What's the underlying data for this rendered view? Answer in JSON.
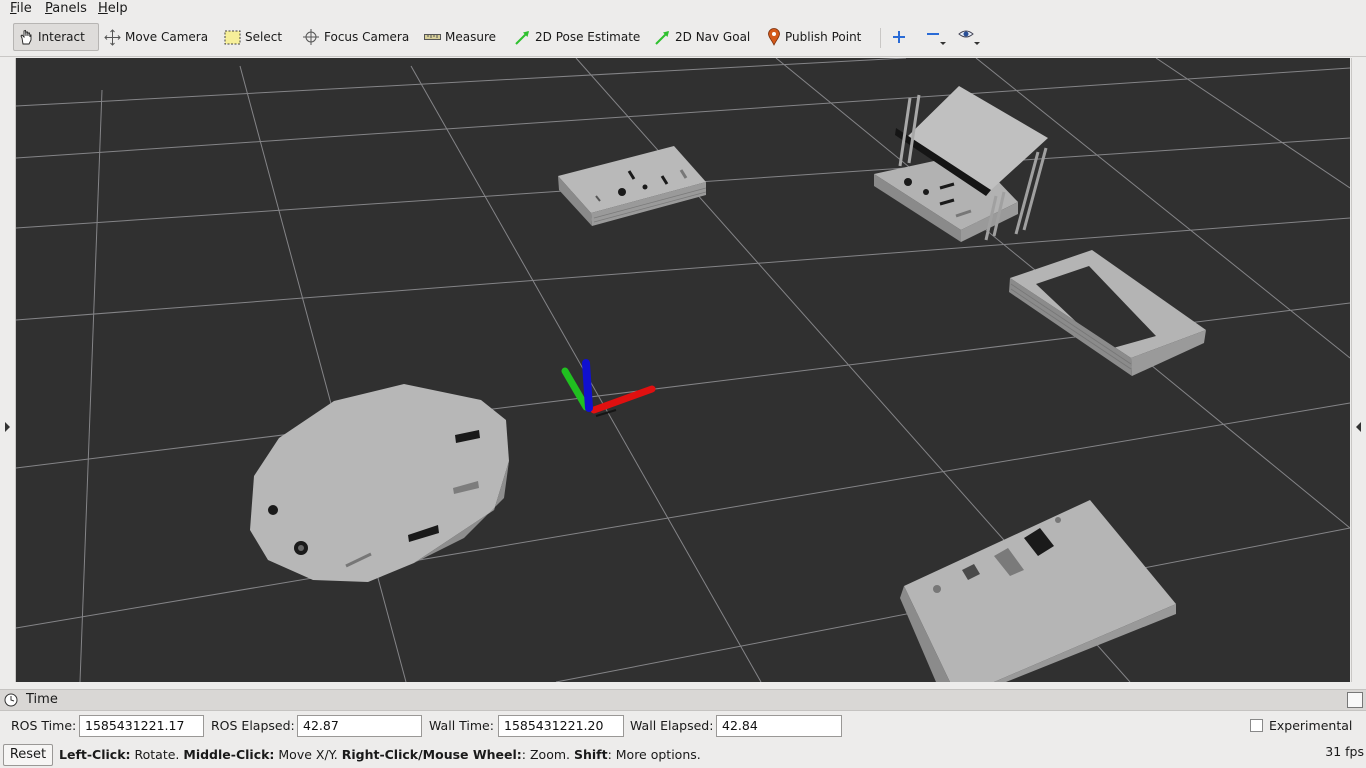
{
  "menubar": {
    "file": {
      "u": "F",
      "rest": "ile"
    },
    "panels": {
      "u": "P",
      "rest": "anels"
    },
    "help": {
      "u": "H",
      "rest": "elp"
    }
  },
  "toolbar": {
    "interact": "Interact",
    "move_camera": "Move Camera",
    "select": "Select",
    "focus_camera": "Focus Camera",
    "measure": "Measure",
    "pose_estimate": "2D Pose Estimate",
    "nav_goal": "2D Nav Goal",
    "publish_point": "Publish Point"
  },
  "time_panel": {
    "title": "Time",
    "ros_time_label": "ROS Time:",
    "ros_time": "1585431221.17",
    "ros_elapsed_label": "ROS Elapsed:",
    "ros_elapsed": "42.87",
    "wall_time_label": "Wall Time:",
    "wall_time": "1585431221.20",
    "wall_elapsed_label": "Wall Elapsed:",
    "wall_elapsed": "42.84",
    "experimental_label": "Experimental"
  },
  "status": {
    "reset": "Reset",
    "left_click": "Left-Click:",
    "rotate": " Rotate. ",
    "middle_click": "Middle-Click:",
    "move_xy": " Move X/Y. ",
    "right_click": "Right-Click/Mouse Wheel:",
    "zoom": ": Zoom. ",
    "shift": "Shift",
    "more": ": More options.",
    "fps": "31 fps"
  },
  "colors": {
    "viewport_bg": "#303030",
    "grid": "#a0a0a4",
    "part": "#b4b4b4",
    "axis_x": "#e01010",
    "axis_y": "#20c020",
    "axis_z": "#1010d0"
  }
}
